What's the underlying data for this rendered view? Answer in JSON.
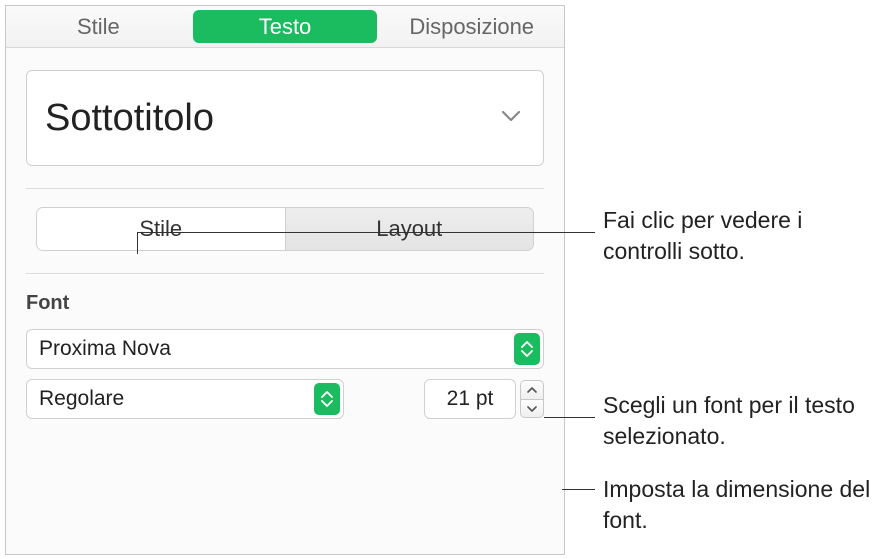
{
  "tabs": {
    "stile": "Stile",
    "testo": "Testo",
    "disposizione": "Disposizione"
  },
  "paragraph_style": {
    "value": "Sottotitolo"
  },
  "segmented": {
    "stile": "Stile",
    "layout": "Layout"
  },
  "font_section": {
    "label": "Font",
    "family": "Proxima Nova",
    "typeface": "Regolare",
    "size": "21 pt"
  },
  "callouts": {
    "c1": "Fai clic per vedere i controlli sotto.",
    "c2": "Scegli un font per il testo selezionato.",
    "c3": "Imposta la dimensione del font."
  }
}
